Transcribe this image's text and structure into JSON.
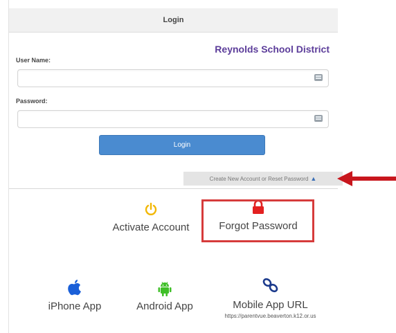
{
  "login": {
    "header_title": "Login",
    "district": "Reynolds School District",
    "username_label": "User Name:",
    "username_value": "",
    "password_label": "Password:",
    "password_value": "",
    "login_button": "Login",
    "create_link": "Create New Account or Reset Password",
    "create_icon": "chevron-up-icon"
  },
  "options": {
    "activate": {
      "label": "Activate Account",
      "icon": "power-icon",
      "color": "#f2b705"
    },
    "forgot": {
      "label": "Forgot Password",
      "icon": "lock-icon",
      "color": "#e32020"
    }
  },
  "apps": {
    "iphone": {
      "label": "iPhone App",
      "icon": "apple-icon",
      "color": "#1a5fd8"
    },
    "android": {
      "label": "Android App",
      "icon": "android-icon",
      "color": "#3fbf28"
    },
    "mobile_url": {
      "label": "Mobile App URL",
      "url": "https://parentvue.beaverton.k12.or.us",
      "icon": "link-icon",
      "color": "#1b3a8c"
    }
  },
  "annotations": {
    "arrow_color": "#c8161d",
    "box_color": "#d63b3b"
  }
}
